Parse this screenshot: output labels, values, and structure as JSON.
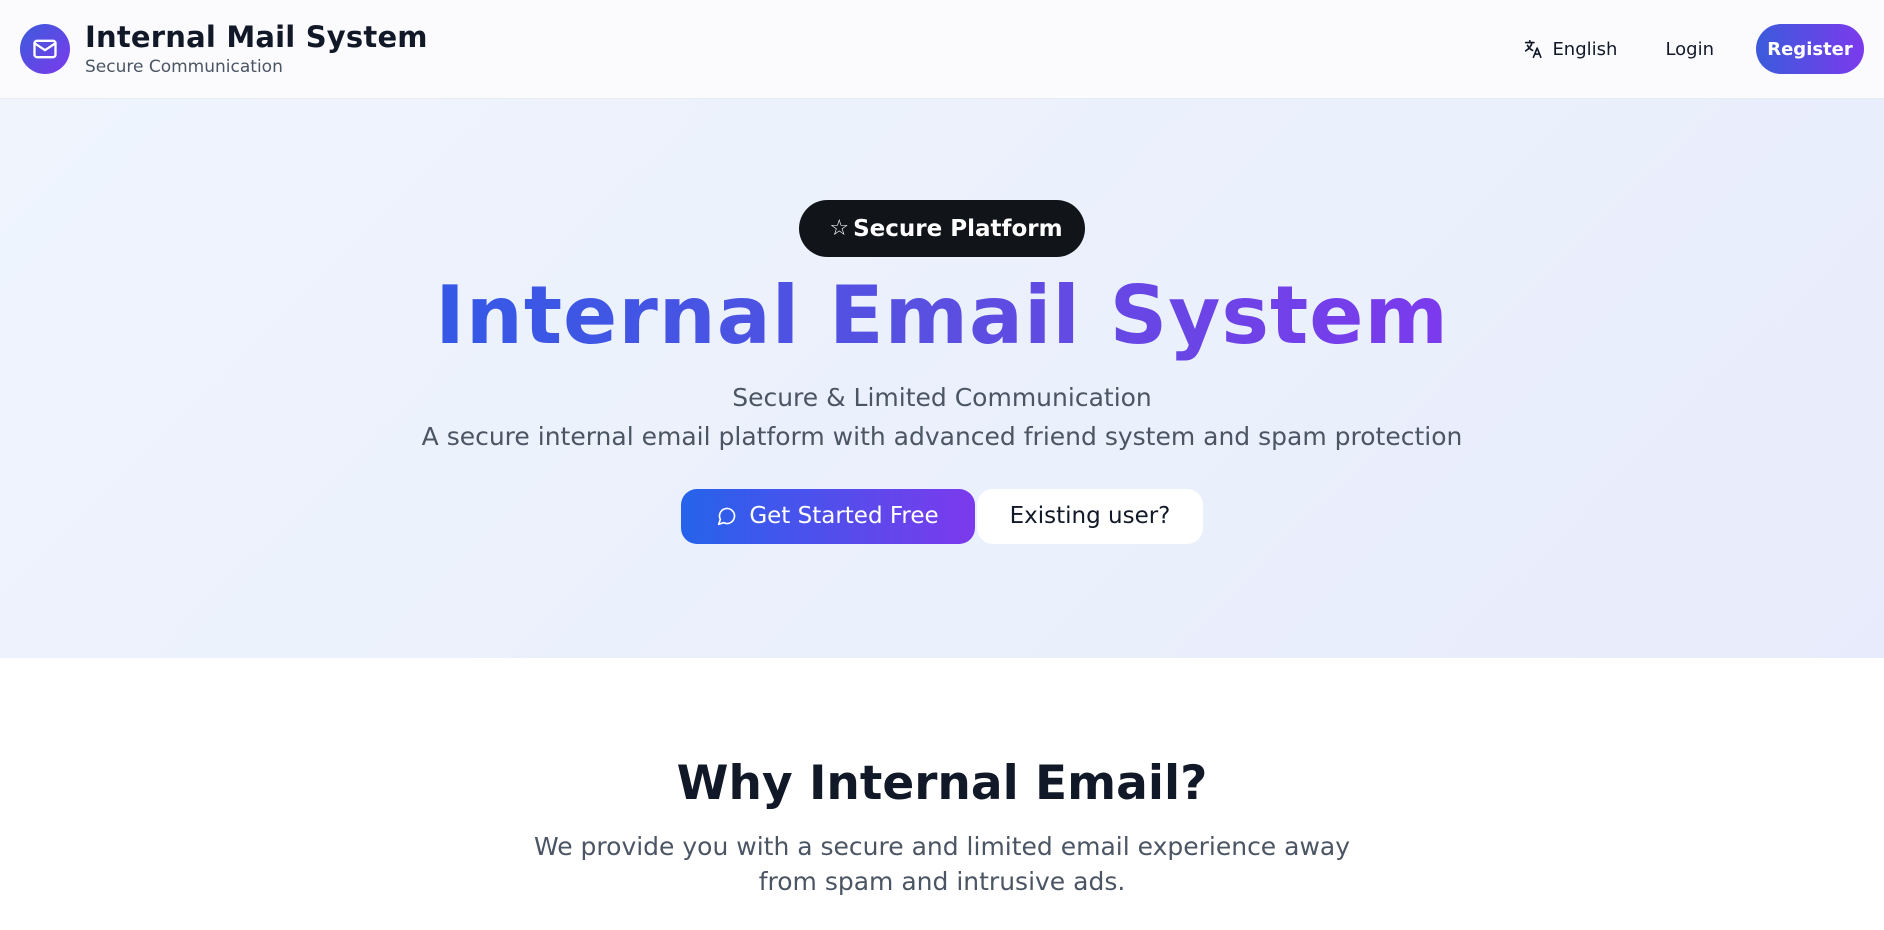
{
  "header": {
    "brand_title": "Internal Mail System",
    "brand_subtitle": "Secure Communication",
    "logo_icon": "mail-icon",
    "language_label": "English",
    "language_icon": "translate-icon",
    "login_label": "Login",
    "register_label": "Register"
  },
  "hero": {
    "badge_icon": "star-icon",
    "badge_label": "Secure Platform",
    "title": "Internal Email System",
    "subtitle": "Secure & Limited Communication",
    "description": "A secure internal email platform with advanced friend system and spam protection",
    "primary_cta_icon": "chat-bubble-icon",
    "primary_cta_label": "Get Started Free",
    "secondary_cta_label": "Existing user?"
  },
  "why": {
    "title": "Why Internal Email?",
    "description": "We provide you with a secure and limited email experience away from spam and intrusive ads."
  },
  "colors": {
    "accent_start": "#3b5bdb",
    "accent_end": "#7c3aed",
    "badge_bg": "#111418",
    "text_primary": "#111827",
    "text_secondary": "#4b5563"
  }
}
